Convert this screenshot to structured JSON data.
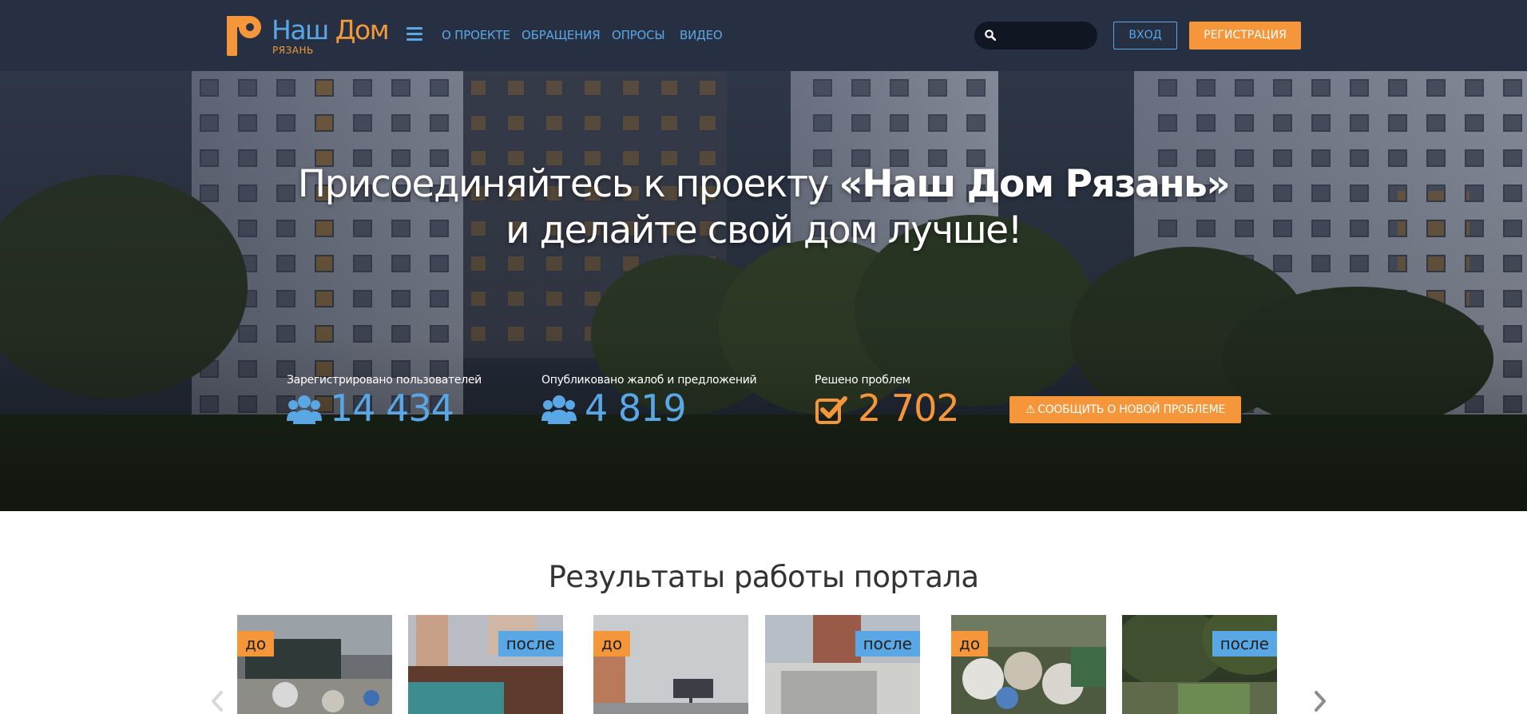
{
  "brand": {
    "name_part1": "Наш",
    "name_part2": "Дом",
    "city": "РЯЗАНЬ",
    "primary_color": "#5aa7e6",
    "accent_color": "#f6963a",
    "nav_background": "#273043"
  },
  "nav": {
    "menu_icon": "hamburger-icon",
    "links": [
      {
        "label": "О ПРОЕКТЕ"
      },
      {
        "label": "ОБРАЩЕНИЯ"
      },
      {
        "label": "ОПРОСЫ"
      },
      {
        "label": "ВИДЕО"
      }
    ],
    "search": {
      "icon": "search-icon",
      "placeholder": "",
      "value": ""
    },
    "login_label": "ВХОД",
    "register_label": "РЕГИСТРАЦИЯ"
  },
  "hero": {
    "title_line1_prefix": "Присоединяйтесь к проекту ",
    "title_line1_bold": "«Наш Дом Рязань»",
    "title_line2": "и делайте свой дом лучше!",
    "stats": [
      {
        "label": "Зарегистрировано пользователей",
        "value": "14 434",
        "icon": "users-icon"
      },
      {
        "label": "Опубликовано жалоб и предложений",
        "value": "4 819",
        "icon": "users-icon"
      },
      {
        "label": "Решено проблем",
        "value": "2 702",
        "icon": "check-square-icon"
      }
    ],
    "report_button": {
      "icon": "warning-icon",
      "label": "СООБЩИТЬ О НОВОЙ ПРОБЛЕМЕ"
    }
  },
  "results": {
    "title": "Результаты работы портала",
    "prev_icon": "chevron-left-icon",
    "next_icon": "chevron-right-icon",
    "photos": [
      {
        "badge": "до",
        "kind": "before"
      },
      {
        "badge": "после",
        "kind": "after"
      },
      {
        "badge": "до",
        "kind": "before"
      },
      {
        "badge": "после",
        "kind": "after"
      },
      {
        "badge": "до",
        "kind": "before"
      },
      {
        "badge": "после",
        "kind": "after"
      }
    ]
  }
}
